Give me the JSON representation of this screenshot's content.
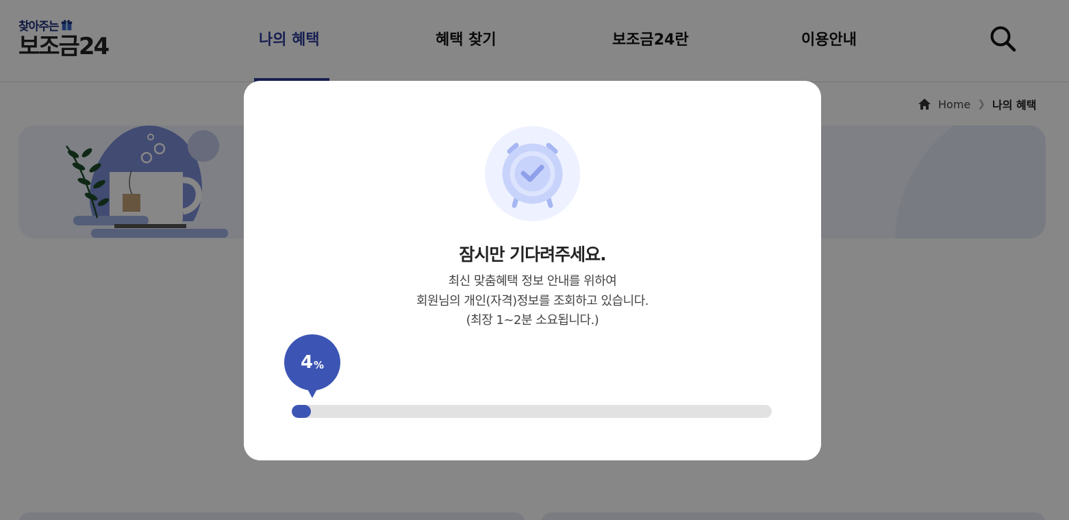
{
  "header": {
    "logo_sub": "찾아주는",
    "logo_main": "보조금24",
    "nav": [
      "나의 혜택",
      "혜택 찾기",
      "보조금24란",
      "이용안내"
    ],
    "active_nav": "나의 혜택",
    "search_icon": "search-icon"
  },
  "breadcrumb": {
    "home": "Home",
    "current": "나의 혜택"
  },
  "modal": {
    "icon": "alarm-clock-check-icon",
    "title": "잠시만 기다려주세요.",
    "desc_lines": [
      "최신 맞춤혜택 정보 안내를 위하여",
      "회원님의 개인(자격)정보를 조회하고 있습니다.",
      "(최장 1~2분 소요됩니다.)"
    ],
    "progress": {
      "value": "4",
      "unit": "%",
      "percent": 4
    }
  },
  "colors": {
    "brand": "#2c3e9c",
    "progress": "#3c55b4",
    "track": "#e2e2e2",
    "overlay": "rgba(0,0,0,0.47)"
  }
}
